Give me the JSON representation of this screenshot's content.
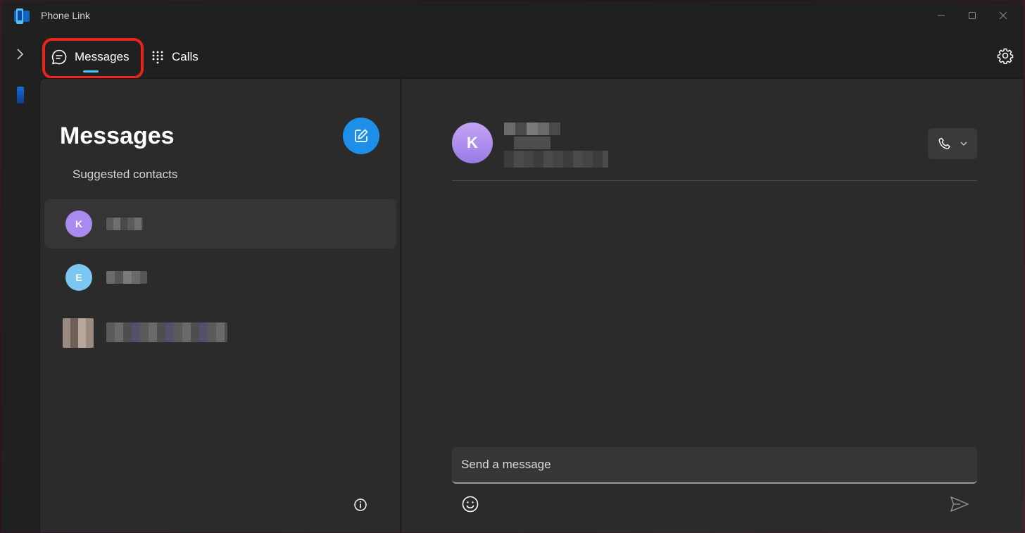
{
  "window": {
    "title": "Phone Link"
  },
  "nav": {
    "tabs": [
      {
        "label": "Messages",
        "icon": "chat-bubble-icon",
        "active": true
      },
      {
        "label": "Calls",
        "icon": "dialpad-icon",
        "active": false
      }
    ]
  },
  "messages": {
    "title": "Messages",
    "suggested_label": "Suggested contacts",
    "contacts": [
      {
        "initial": "K",
        "avatar_color": "#a98bf0",
        "selected": true
      },
      {
        "initial": "E",
        "avatar_color": "#7cc8f2",
        "selected": false
      },
      {
        "initial": "",
        "avatar_color": "#8a7a72",
        "selected": false
      }
    ]
  },
  "chat": {
    "contact_initial": "K",
    "composer_placeholder": "Send a message"
  },
  "colors": {
    "accent": "#1e8fe8",
    "tab_indicator": "#4cc2ff",
    "highlight": "#e8251a"
  }
}
